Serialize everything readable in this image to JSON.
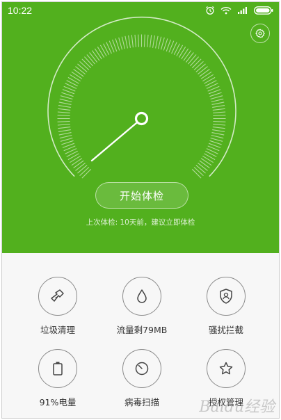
{
  "status_bar": {
    "time": "10:22"
  },
  "main": {
    "start_button": "开始体检",
    "last_check_text": "上次体检: 10天前，建议立即体检"
  },
  "tools": [
    {
      "label": "垃圾清理",
      "icon": "broom-icon"
    },
    {
      "label": "流量剩79MB",
      "icon": "drop-icon"
    },
    {
      "label": "骚扰拦截",
      "icon": "shield-user-icon"
    },
    {
      "label": "91%电量",
      "icon": "battery-icon"
    },
    {
      "label": "病毒扫描",
      "icon": "scan-icon"
    },
    {
      "label": "授权管理",
      "icon": "star-icon"
    }
  ],
  "watermark": "Baidu经验",
  "colors": {
    "hero_bg": "#52b01e",
    "tile_border": "#8a8a8a",
    "label_text": "#333333"
  }
}
